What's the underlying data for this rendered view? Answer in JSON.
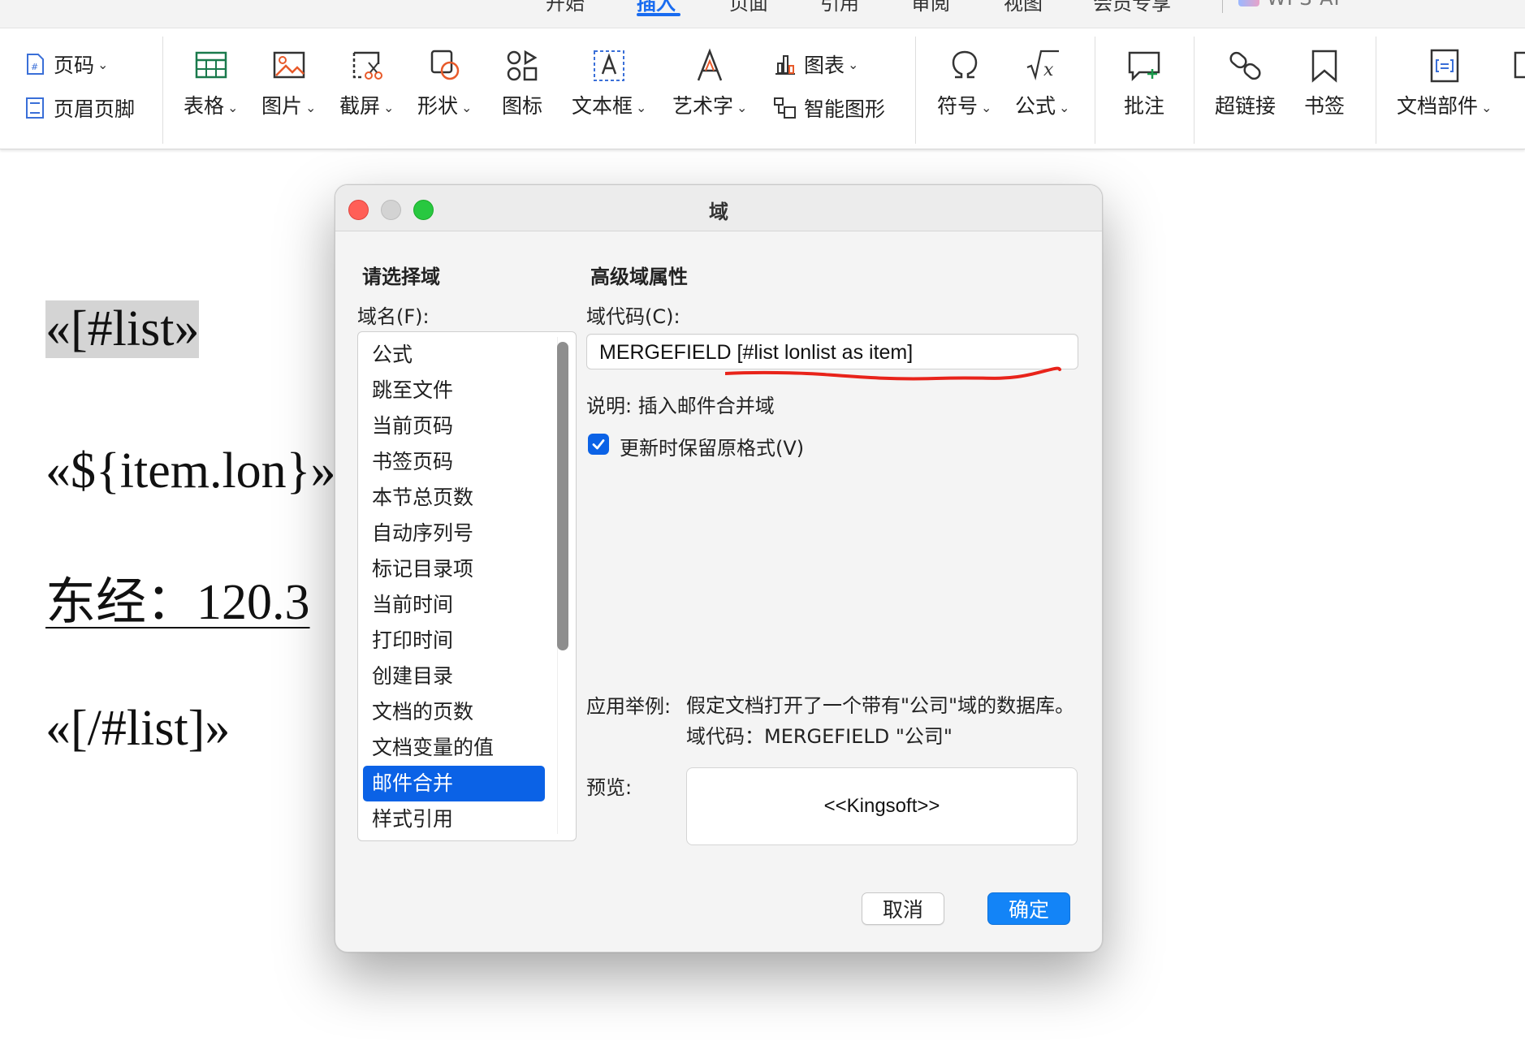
{
  "tabs": [
    {
      "label": "开始",
      "active": false
    },
    {
      "label": "插入",
      "active": true
    },
    {
      "label": "页面",
      "active": false
    },
    {
      "label": "引用",
      "active": false
    },
    {
      "label": "审阅",
      "active": false
    },
    {
      "label": "视图",
      "active": false
    },
    {
      "label": "会员专享",
      "active": false
    }
  ],
  "brand": "WPS AI",
  "ribbon": {
    "page_number": "页码",
    "header_footer": "页眉页脚",
    "table": "表格",
    "picture": "图片",
    "screenshot": "截屏",
    "shape": "形状",
    "icon": "图标",
    "textbox": "文本框",
    "wordart": "艺术字",
    "chart": "图表",
    "smartart": "智能图形",
    "symbol": "符号",
    "formula": "公式",
    "comment": "批注",
    "hyperlink": "超链接",
    "bookmark": "书签",
    "doc_parts": "文档部件"
  },
  "document": {
    "lines": [
      "«[#list»",
      "«${item.lon}»",
      "东经：120.3",
      "«[/#list]»"
    ]
  },
  "dialog": {
    "title": "域",
    "select_field_heading": "请选择域",
    "advanced_heading": "高级域属性",
    "field_name_label": "域名(F):",
    "field_code_label": "域代码(C):",
    "field_code_value": "MERGEFIELD [#list lonlist as item]",
    "description": "说明: 插入邮件合并域",
    "keep_format_label": "更新时保留原格式(V)",
    "keep_format_checked": true,
    "example_label": "应用举例:",
    "example_text": "假定文档打开了一个带有\"公司\"域的数据库。域代码：MERGEFIELD \"公司\"",
    "preview_label": "预览:",
    "preview_value": "<<Kingsoft>>",
    "cancel": "取消",
    "ok": "确定",
    "fields": [
      "公式",
      "跳至文件",
      "当前页码",
      "书签页码",
      "本节总页数",
      "自动序列号",
      "标记目录项",
      "当前时间",
      "打印时间",
      "创建目录",
      "文档的页数",
      "文档变量的值",
      "邮件合并",
      "样式引用"
    ],
    "selected_field": "邮件合并"
  },
  "colors": {
    "accent": "#1a6cf0",
    "selection": "#0b62e6",
    "ok_button": "#1384f7",
    "annotation": "#e8231a"
  }
}
